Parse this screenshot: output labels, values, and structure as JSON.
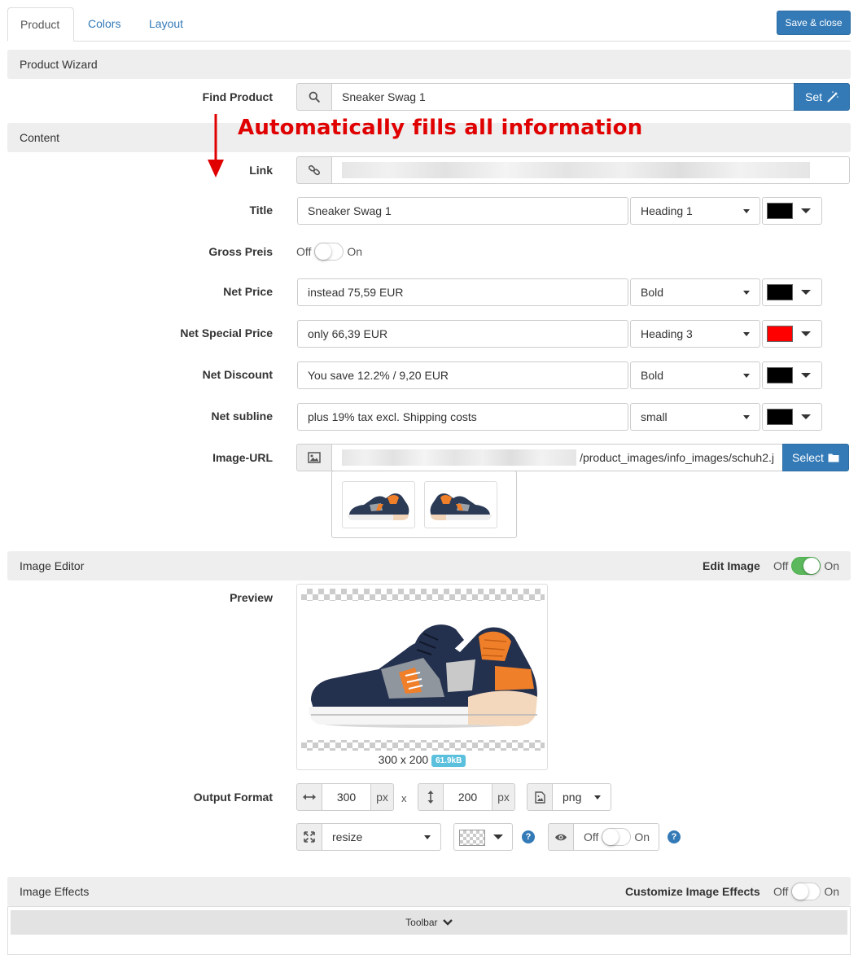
{
  "tabs": [
    "Product",
    "Colors",
    "Layout"
  ],
  "save_button": "Save & close",
  "sections": {
    "product_wizard": "Product Wizard",
    "content": "Content",
    "image_editor": "Image Editor",
    "image_effects": "Image Effects"
  },
  "find_product": {
    "label": "Find Product",
    "value": "Sneaker Swag 1",
    "button": "Set"
  },
  "annotation": "Automatically fills all information",
  "link": {
    "label": "Link",
    "value": ""
  },
  "title_row": {
    "label": "Title",
    "value": "Sneaker Swag 1",
    "style": "Heading 1",
    "color": "#000000"
  },
  "gross_preis": {
    "label": "Gross Preis",
    "off": "Off",
    "on": "On",
    "state": false
  },
  "net_price": {
    "label": "Net Price",
    "value": "instead 75,59 EUR",
    "style": "Bold",
    "color": "#000000"
  },
  "net_special_price": {
    "label": "Net Special Price",
    "value": "only 66,39 EUR",
    "style": "Heading 3",
    "color": "#ff0000"
  },
  "net_discount": {
    "label": "Net Discount",
    "value": "You save 12.2% / 9,20 EUR",
    "style": "Bold",
    "color": "#000000"
  },
  "net_subline": {
    "label": "Net subline",
    "value": "plus 19% tax excl. Shipping costs",
    "style": "small",
    "color": "#000000"
  },
  "image_url": {
    "label": "Image-URL",
    "value": "/product_images/info_images/schuh2.j",
    "button": "Select"
  },
  "edit_image": {
    "label": "Edit Image",
    "off": "Off",
    "on": "On",
    "state": true
  },
  "preview": {
    "label": "Preview",
    "dimensions": "300 x 200",
    "size_badge": "61.9kB"
  },
  "output_format": {
    "label": "Output Format",
    "width": "300",
    "height": "200",
    "unit": "px",
    "times": "x",
    "format": "png",
    "mode": "resize",
    "visibility_off": "Off",
    "visibility_on": "On",
    "help": "?"
  },
  "customize_effects": {
    "label": "Customize Image Effects",
    "off": "Off",
    "on": "On",
    "state": false
  },
  "toolbar": {
    "label": "Toolbar"
  }
}
